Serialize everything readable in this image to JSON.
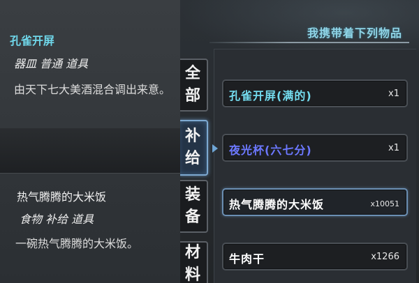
{
  "header": {
    "title": "我携带着下列物品"
  },
  "tabs": [
    {
      "label_1": "全",
      "label_2": "部"
    },
    {
      "label_1": "补",
      "label_2": "给"
    },
    {
      "label_1": "装",
      "label_2": "备"
    },
    {
      "label_1": "材",
      "label_2": "料"
    }
  ],
  "items": [
    {
      "name": "孔雀开屏(满的)",
      "qty": "x1",
      "color": "#74dcef"
    },
    {
      "name": "夜光杯(六七分)",
      "qty": "x1",
      "color": "#6c78ff"
    },
    {
      "name": "热气腾腾的大米饭",
      "qty": "x10051",
      "color": "#ffffff"
    },
    {
      "name": "牛肉干",
      "qty": "x1266",
      "color": "#ffffff"
    }
  ],
  "info_top": {
    "title": "孔雀开屏",
    "tags": "器皿 普通 道具",
    "desc": "由天下七大美酒混合调出来意。"
  },
  "info_bottom": {
    "title": "热气腾腾的大米饭",
    "tags": "食物 补给 道具",
    "desc": "一碗热气腾腾的大米饭。"
  },
  "colors": {
    "accent_cyan": "#74dcef",
    "accent_blue": "#6c78ff",
    "selected_border": "#7da9d1"
  }
}
